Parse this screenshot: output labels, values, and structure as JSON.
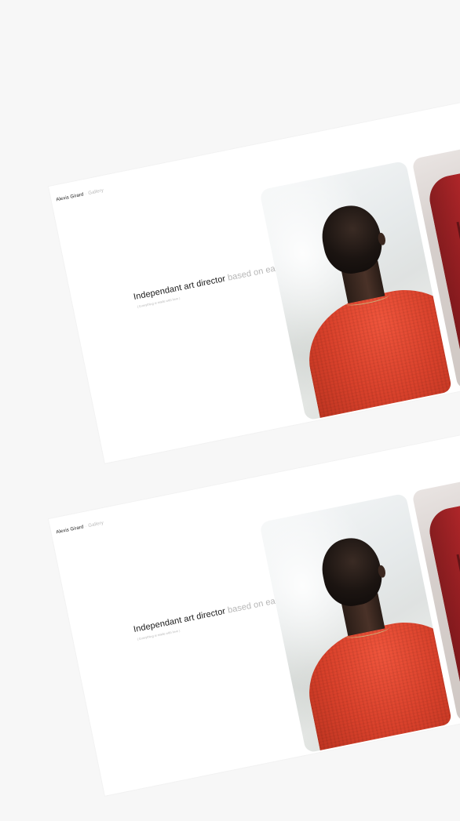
{
  "cards": [
    {
      "brand": {
        "name": "Alexis Girard",
        "separator": "·",
        "link": "Gallery"
      },
      "headline": {
        "strong": "Independant art director",
        "muted": "based on earth"
      },
      "subtitle": "( Everything is made with love )"
    },
    {
      "brand": {
        "name": "Alexis Girard",
        "separator": "·",
        "link": "Gallery"
      },
      "headline": {
        "strong": "Independant art director",
        "muted": "based on earth"
      },
      "subtitle": "( Everything is made with love )"
    }
  ],
  "colors": {
    "background": "#f7f7f7",
    "card": "#ffffff",
    "text_strong": "#1a1a1a",
    "text_muted": "#b5b5b5",
    "sweater_red": "#d9412b",
    "jacket_red": "#8f1c20"
  }
}
